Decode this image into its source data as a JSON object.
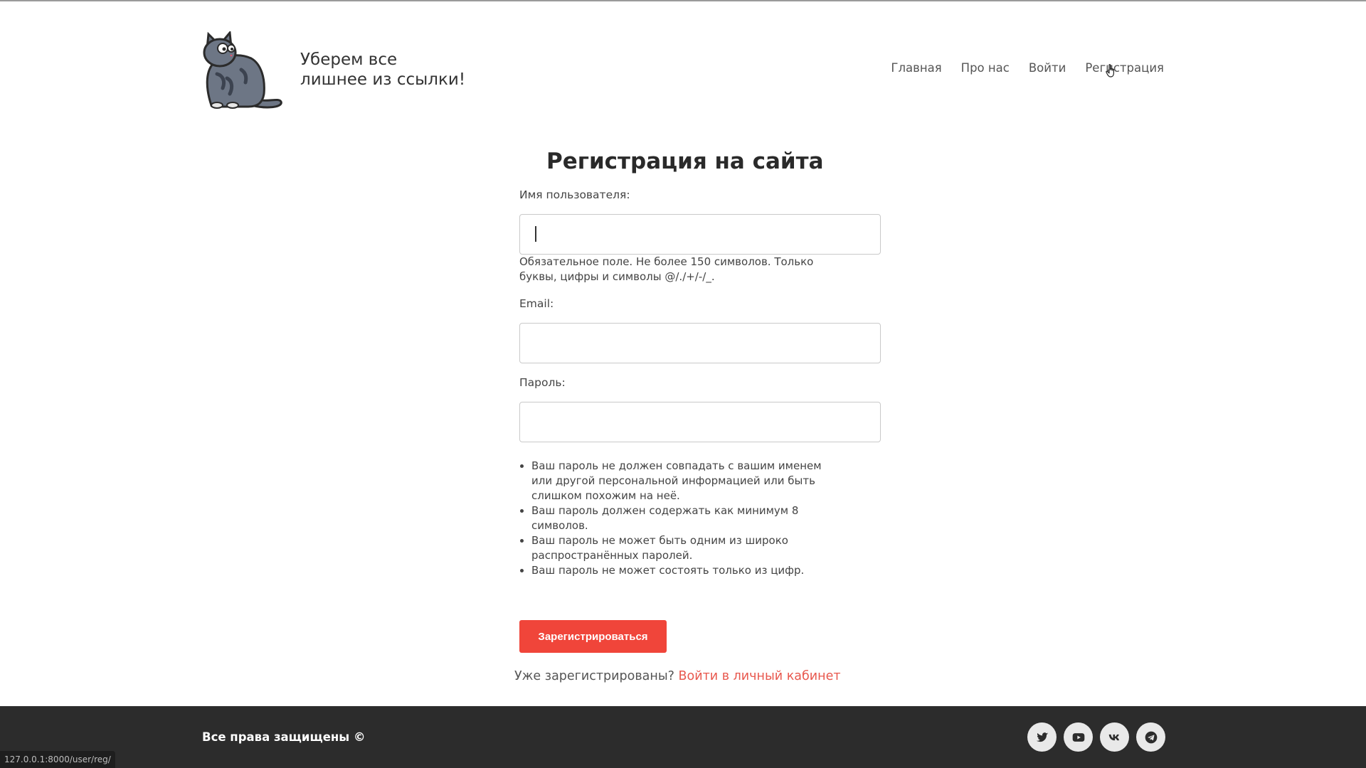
{
  "header": {
    "tagline_line1": "Уберем все",
    "tagline_line2": "лишнее из ссылки!",
    "nav": [
      "Главная",
      "Про нас",
      "Войти",
      "Регистрация"
    ]
  },
  "form": {
    "title": "Регистрация на сайта",
    "username_label": "Имя пользователя:",
    "username_value": "",
    "username_help_line1": "Обязательное поле. Не более 150 символов. Только",
    "username_help_line2": "буквы, цифры и символы @/./+/-/_.",
    "email_label": "Email:",
    "email_value": "",
    "password_label": "Пароль:",
    "password_value": "",
    "password_rules": [
      "Ваш пароль не должен совпадать с вашим именем или другой персональной информацией или быть слишком похожим на неё.",
      "Ваш пароль должен содержать как минимум 8 символов.",
      "Ваш пароль не может быть одним из широко распространённых паролей.",
      "Ваш пароль не может состоять только из цифр."
    ],
    "submit_label": "Зарегистрироваться",
    "already_text": "Уже зарегистрированы?",
    "login_link": "Войти в личный кабинет"
  },
  "footer": {
    "copyright": "Все права защищены ©",
    "socials": [
      "twitter-icon",
      "youtube-icon",
      "vk-icon",
      "telegram-icon"
    ]
  },
  "statusbar": {
    "url": "127.0.0.1:8000/user/reg/"
  },
  "colors": {
    "accent": "#f0453a",
    "link": "#e8584e",
    "footer_bg": "#2c2c2c"
  }
}
